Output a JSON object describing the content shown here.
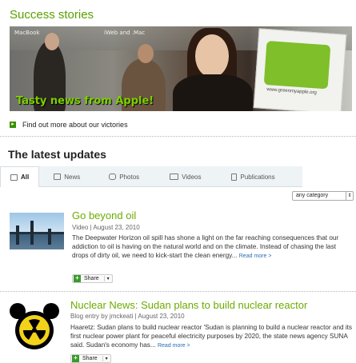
{
  "success": {
    "title": "Success stories",
    "banner_tagline": "Tasty news from Apple!",
    "banner_labels": [
      "MacBook",
      "iWeb and .Mac"
    ],
    "poster_url": "www.greenmyapple.org",
    "link_text": "Find out more about our victories"
  },
  "latest": {
    "title": "The latest updates",
    "tabs": [
      {
        "label": "All",
        "icon": "all-icon",
        "active": true
      },
      {
        "label": "News",
        "icon": "news-icon"
      },
      {
        "label": "Photos",
        "icon": "camera-icon"
      },
      {
        "label": "Videos",
        "icon": "video-camera-icon"
      },
      {
        "label": "Publications",
        "icon": "document-icon"
      }
    ],
    "category_select": "any category"
  },
  "items": [
    {
      "title": "Go beyond oil",
      "meta": "Video | August 23, 2010",
      "body": "The Deepwater Horizon oil spill has shone a light on the far reaching consequences that our addiction to oil is having on the natural world and on the climate. Instead of chasing the last drops of dirty oil, we need to kick-start the clean energy...",
      "more": "Read more >",
      "share": "Share"
    },
    {
      "title": "Nuclear News: Sudan plans to build nuclear reactor",
      "meta": "Blog entry by jmckeati | August 23, 2010",
      "body": "Haaretz: Sudan plans to build nuclear reactor 'Sudan is planning to build a nuclear reactor and its first nuclear power plant for peaceful electricity purposes by 2020, the state news agency SUNA said. Sudan's economy has...",
      "more": "Read more >",
      "share": "Share"
    }
  ],
  "colors": {
    "accent_green": "#6cab00",
    "link_blue": "#2a6db5",
    "share_green": "#3a9b2c"
  }
}
